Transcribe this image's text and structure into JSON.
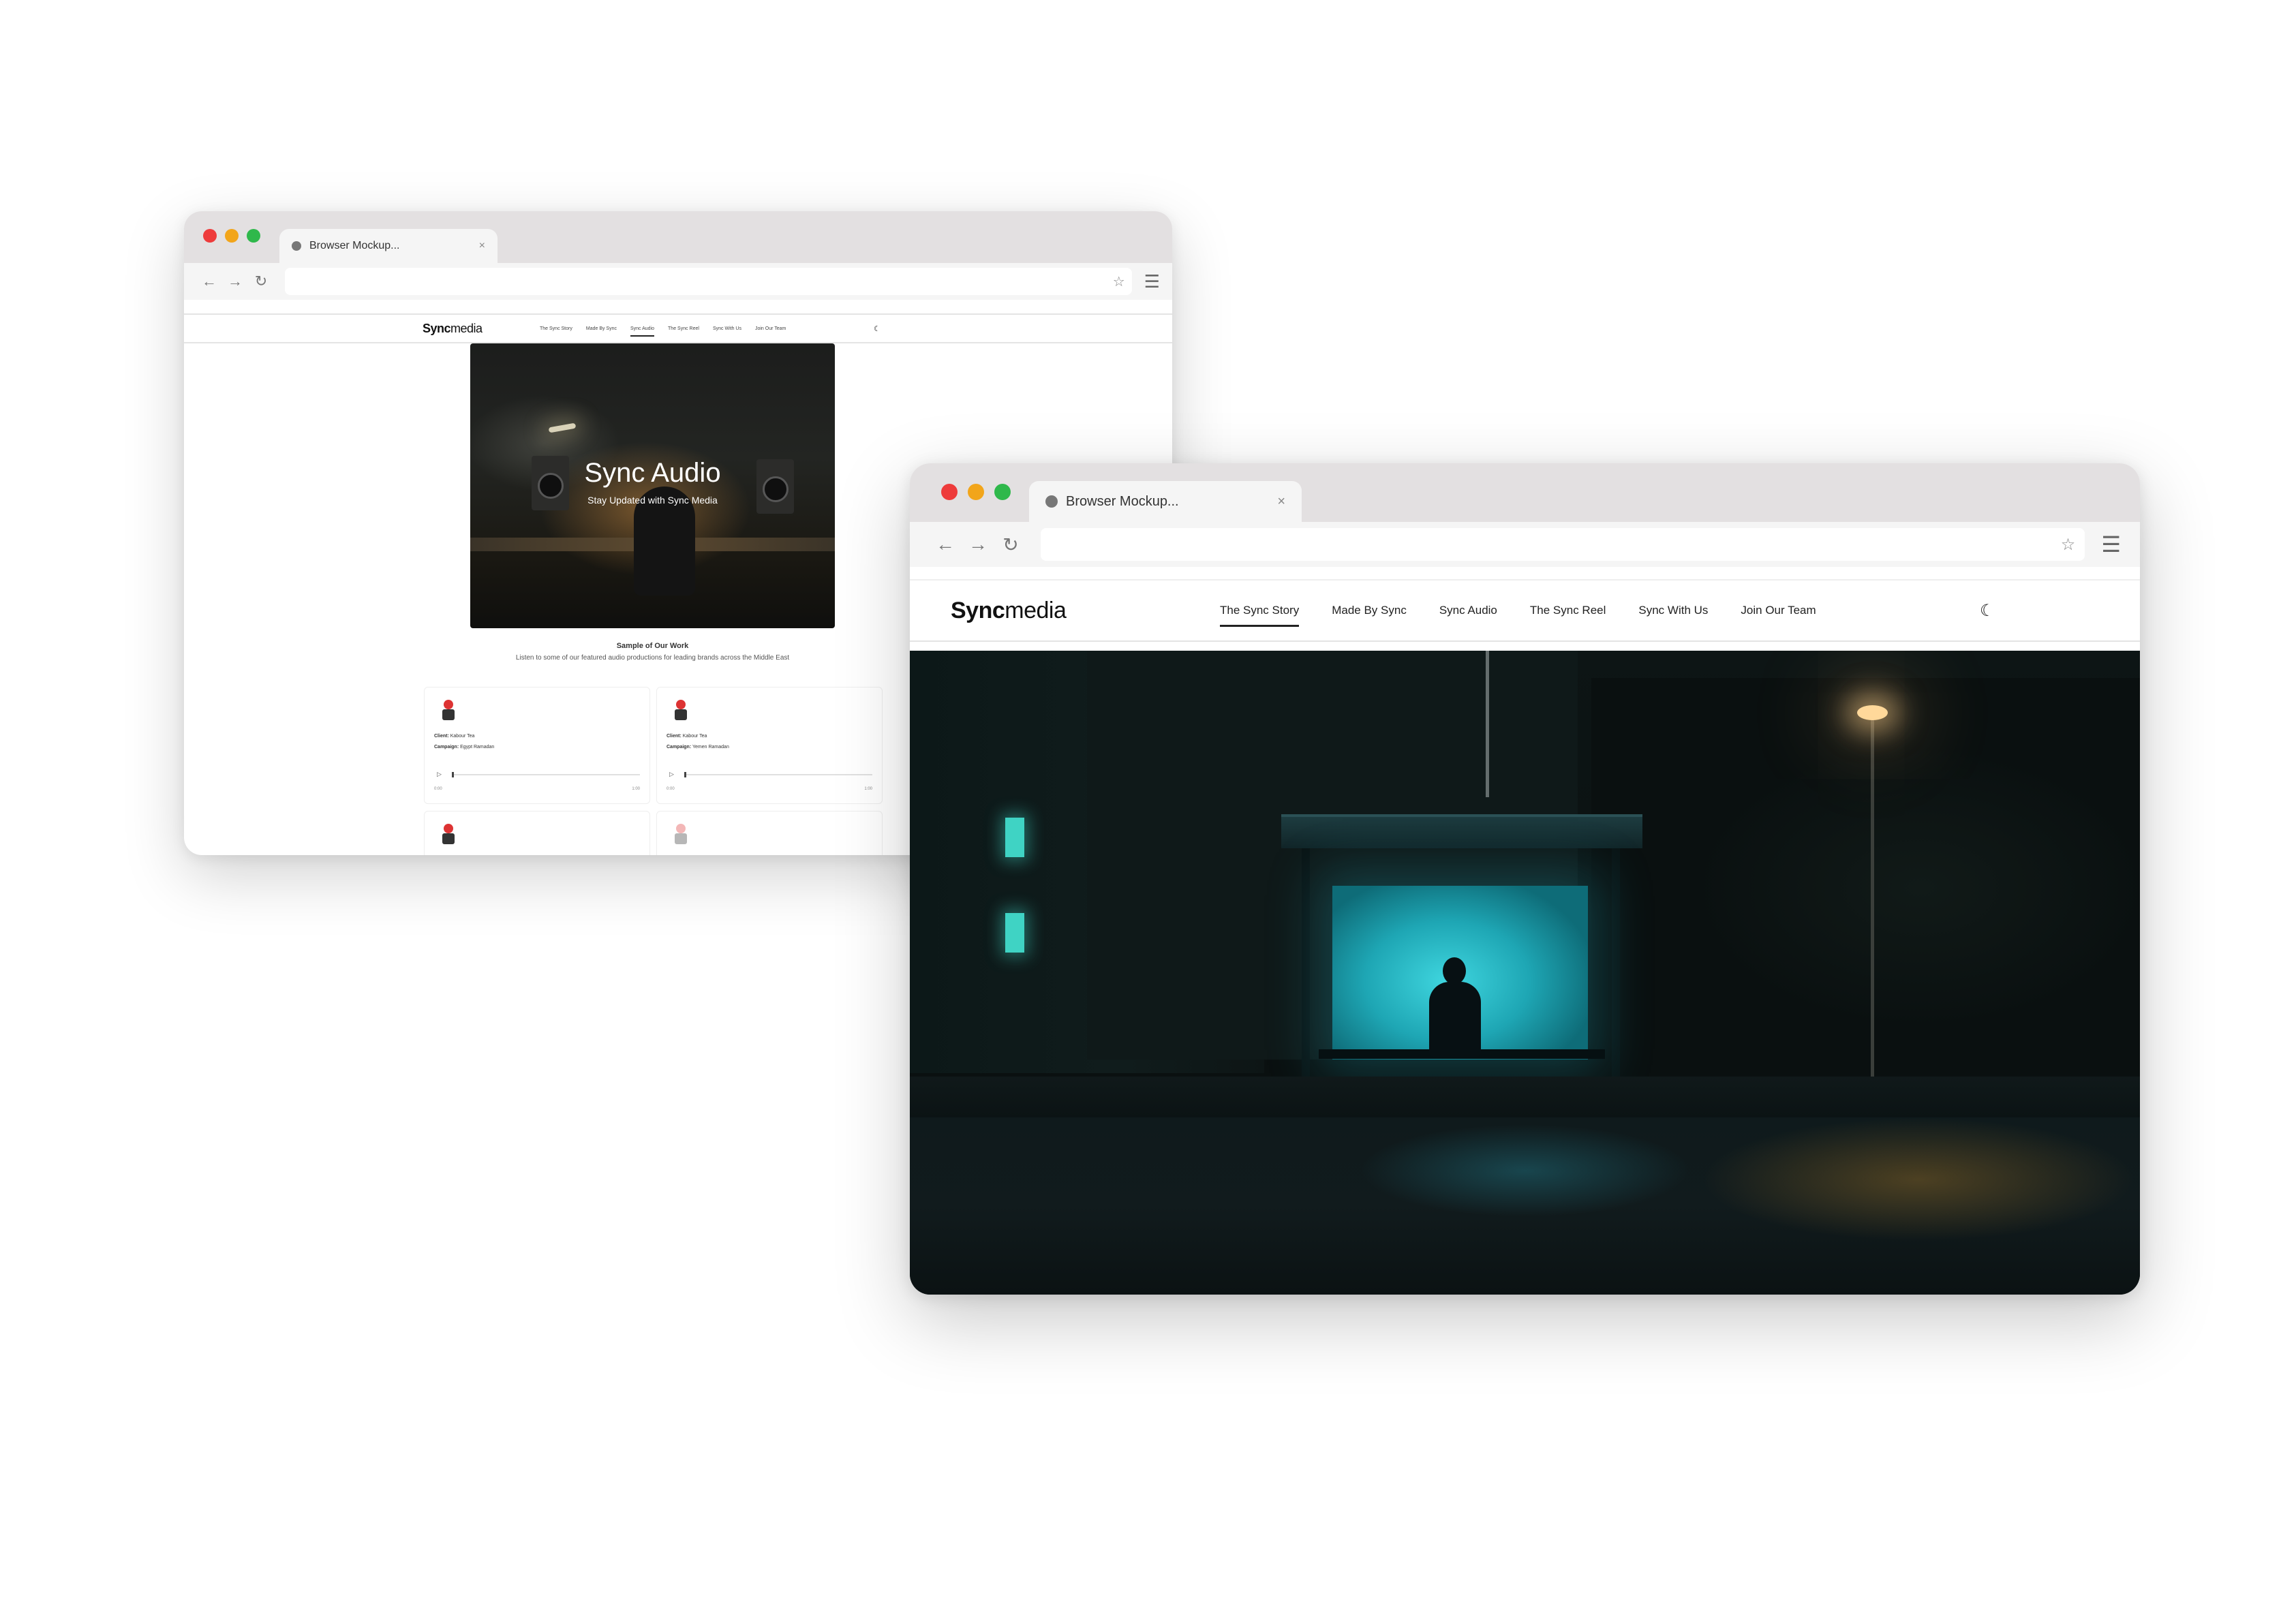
{
  "back_browser": {
    "tab_title": "Browser Mockup...",
    "tab_close": "×",
    "nav": {
      "back": "←",
      "forward": "→",
      "reload": "↻",
      "star": "☆",
      "menu": "☰"
    },
    "site": {
      "logo_bold": "Sync",
      "logo_light": "media",
      "nav_items": [
        "The Sync Story",
        "Made By Sync",
        "Sync Audio",
        "The Sync Reel",
        "Sync With Us",
        "Join Our Team"
      ],
      "active_nav": "Sync Audio",
      "theme_toggle": "☾",
      "hero_title": "Sync Audio",
      "hero_subtitle": "Stay Updated with Sync Media",
      "section_title": "Sample of Our Work",
      "section_description": "Listen to some of our featured audio productions for leading brands across the Middle East",
      "cards": [
        {
          "client_label": "Client:",
          "client": "Kabour Tea",
          "campaign_label": "Campaign:",
          "campaign": "Egypt Ramadan",
          "time_start": "0:00",
          "time_end": "1:00"
        },
        {
          "client_label": "Client:",
          "client": "Kabour Tea",
          "campaign_label": "Campaign:",
          "campaign": "Yemen Ramadan",
          "time_start": "0:00",
          "time_end": "1:00"
        }
      ]
    }
  },
  "front_browser": {
    "tab_title": "Browser Mockup...",
    "tab_close": "×",
    "nav": {
      "back": "←",
      "forward": "→",
      "reload": "↻",
      "star": "☆",
      "menu": "☰"
    },
    "site": {
      "logo_bold": "Sync",
      "logo_light": "media",
      "nav_items": [
        "The Sync Story",
        "Made By Sync",
        "Sync Audio",
        "The Sync Reel",
        "Sync With Us",
        "Join Our Team"
      ],
      "active_nav": "The Sync Story",
      "theme_toggle": "☾"
    }
  },
  "colors": {
    "traffic_red": "#ee3b3b",
    "traffic_yellow": "#f2a51a",
    "traffic_green": "#2fb84b",
    "chrome_bg": "#e3e0e1",
    "bus_shelter_glow": "#3fd6df"
  }
}
